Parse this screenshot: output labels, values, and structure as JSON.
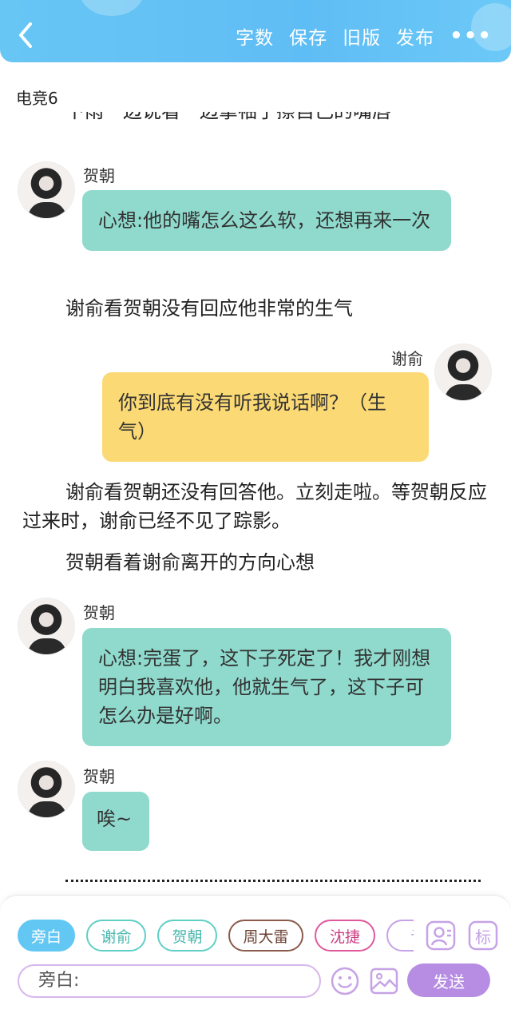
{
  "header": {
    "actions": [
      "字数",
      "保存",
      "旧版",
      "发布"
    ],
    "more": "•••"
  },
  "doc": {
    "title": "电竞6"
  },
  "messages": {
    "top_cut": "下雨一边说看一边拿袖子擦自己的嘴唇",
    "m1_speaker": "贺朝",
    "m1_text": "心想:他的嘴怎么这么软，还想再来一次",
    "n1": "谢俞看贺朝没有回应他非常的生气",
    "m2_speaker": "谢俞",
    "m2_text": "你到底有没有听我说话啊？（生气）",
    "n2": "谢俞看贺朝还没有回答他。立刻走啦。等贺朝反应过来时，谢俞已经不见了踪影。",
    "n3": "贺朝看着谢俞离开的方向心想",
    "m3_speaker": "贺朝",
    "m3_text": "心想:完蛋了，这下子死定了！我才刚想明白我喜欢他，他就生气了，这下子可怎么办是好啊。",
    "m4_speaker": "贺朝",
    "m4_text": "唉~"
  },
  "composer": {
    "chips": [
      "旁白",
      "谢俞",
      "贺朝",
      "周大雷",
      "沈捷",
      "许"
    ],
    "input_text": "旁白:",
    "send": "发送",
    "tag_icon_label": "标"
  },
  "colors": {
    "header": "#5fbdf5",
    "teal_bubble": "#8fdacd",
    "yellow_bubble": "#fbd974",
    "send": "#b68de2"
  }
}
